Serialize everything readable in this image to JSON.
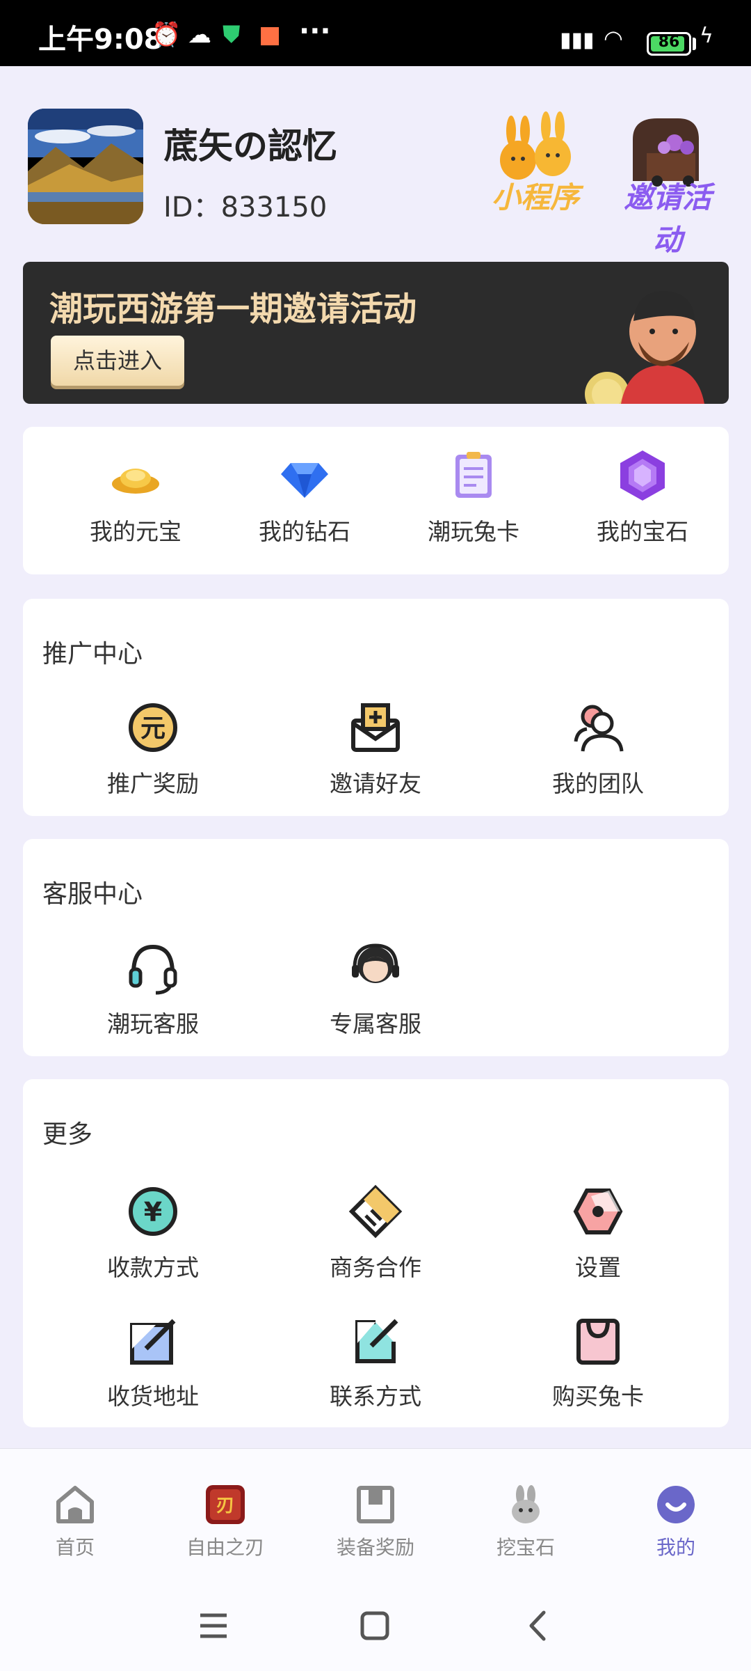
{
  "status_bar": {
    "time": "上午9:08",
    "battery": "86",
    "more": "···"
  },
  "profile": {
    "username": "菧矢の認忆",
    "id_text": "ID：833150"
  },
  "top_actions": [
    {
      "label": "小程序",
      "icon": "bunny-mascot-icon"
    },
    {
      "label": "邀请活动",
      "icon": "treasure-cart-icon"
    }
  ],
  "banner": {
    "title": "潮玩西游第一期邀请活动",
    "button": "点击进入"
  },
  "wallet": [
    {
      "label": "我的元宝",
      "icon": "gold-ingot-icon"
    },
    {
      "label": "我的钻石",
      "icon": "diamond-icon"
    },
    {
      "label": "潮玩兔卡",
      "icon": "clipboard-card-icon"
    },
    {
      "label": "我的宝石",
      "icon": "gem-icon"
    }
  ],
  "promotion": {
    "title": "推广中心",
    "items": [
      {
        "label": "推广奖励",
        "icon": "yuan-coin-icon"
      },
      {
        "label": "邀请好友",
        "icon": "invite-mail-icon"
      },
      {
        "label": "我的团队",
        "icon": "team-icon"
      }
    ]
  },
  "service": {
    "title": "客服中心",
    "items": [
      {
        "label": "潮玩客服",
        "icon": "headset-icon"
      },
      {
        "label": "专属客服",
        "icon": "agent-icon"
      }
    ]
  },
  "more": {
    "title": "更多",
    "items": [
      {
        "label": "收款方式",
        "icon": "yen-coin-icon"
      },
      {
        "label": "商务合作",
        "icon": "cooperation-icon"
      },
      {
        "label": "设置",
        "icon": "settings-icon"
      },
      {
        "label": "收货地址",
        "icon": "address-edit-icon"
      },
      {
        "label": "联系方式",
        "icon": "contact-edit-icon"
      },
      {
        "label": "购买兔卡",
        "icon": "shopping-bag-icon"
      }
    ]
  },
  "bottom_nav": [
    {
      "label": "首页",
      "icon": "home-icon",
      "active": false
    },
    {
      "label": "自由之刃",
      "icon": "game-app-icon",
      "active": false
    },
    {
      "label": "装备奖励",
      "icon": "equipment-box-icon",
      "active": false
    },
    {
      "label": "挖宝石",
      "icon": "rabbit-icon",
      "active": false
    },
    {
      "label": "我的",
      "icon": "profile-smile-icon",
      "active": true
    }
  ],
  "colors": {
    "accent": "#6a67c9",
    "background": "#f0eefb",
    "banner_bg": "#2c2c2c",
    "banner_text": "#f3d9ae"
  }
}
